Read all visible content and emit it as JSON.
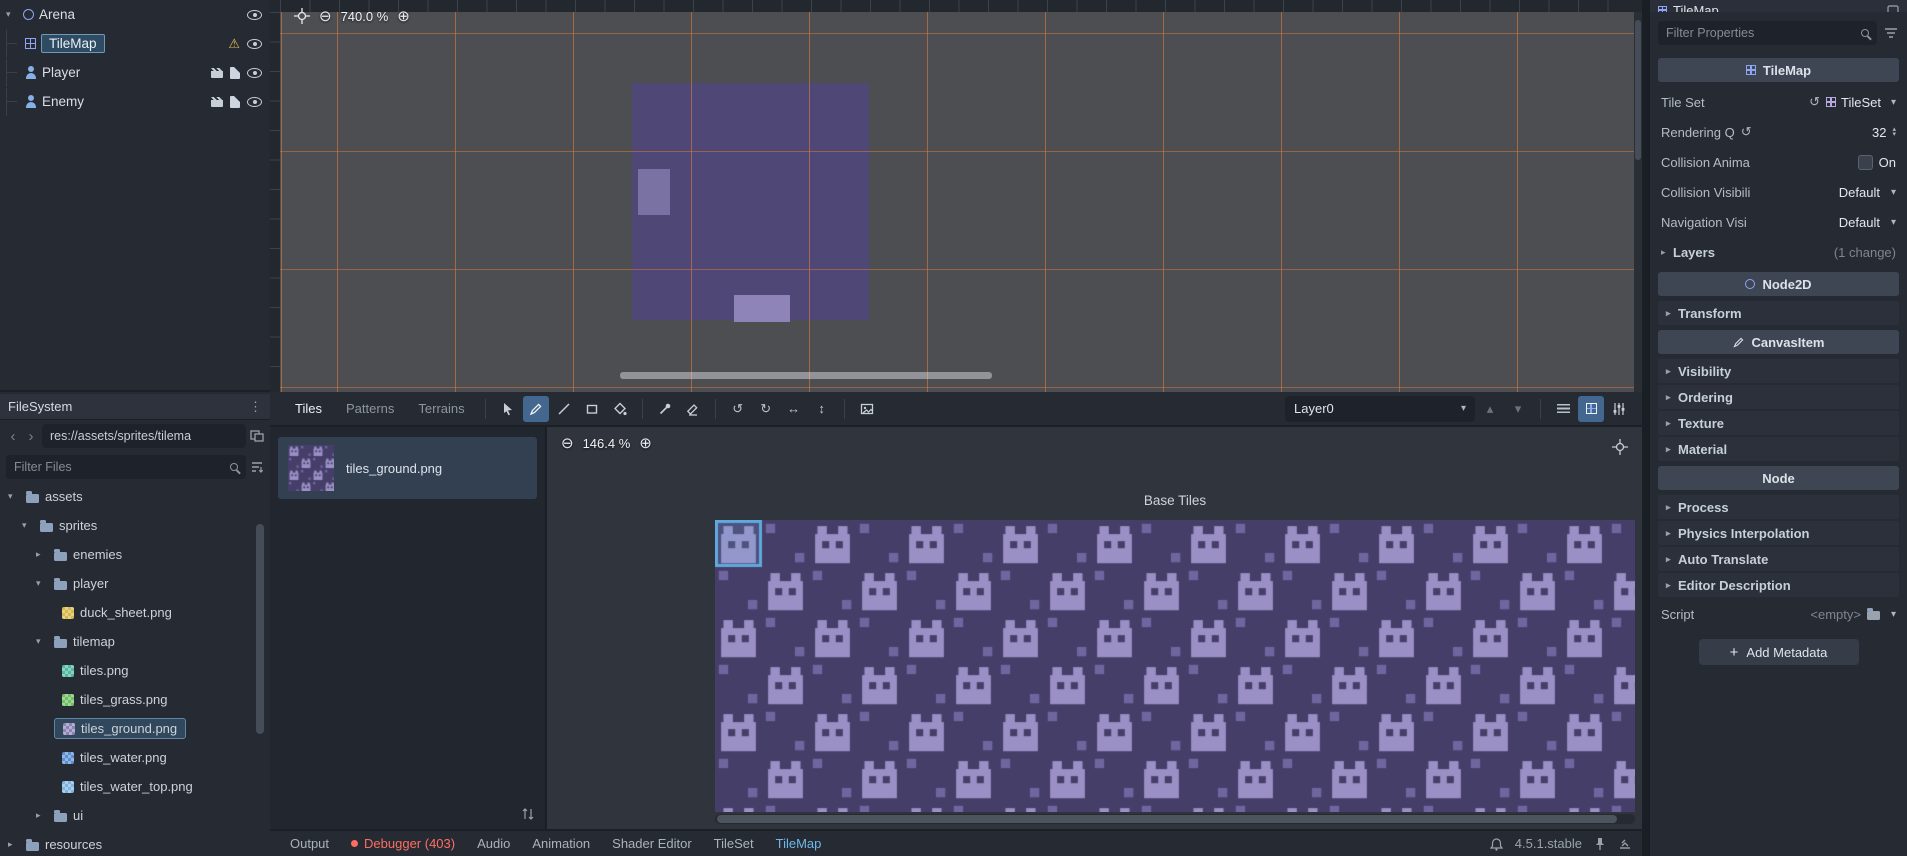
{
  "colors": {
    "accent": "#5fa9dd",
    "grid_orange": "#d4763b",
    "tile_dark": "#453e68",
    "tile_mid": "#6f66a0",
    "tile_light": "#9b90c5",
    "map_purple": "#4f4876",
    "map_light1": "#7b72a4",
    "map_light2": "#8e84b7",
    "warning": "#e0b84f",
    "error_red": "#ff6d61"
  },
  "scene_tree": {
    "nodes": [
      {
        "label": "Arena"
      },
      {
        "label": "TileMap"
      },
      {
        "label": "Player"
      },
      {
        "label": "Enemy"
      }
    ]
  },
  "filesystem": {
    "title": "FileSystem",
    "path": "res://assets/sprites/tilema",
    "filter_placeholder": "Filter Files",
    "items": [
      {
        "label": "assets"
      },
      {
        "label": "sprites"
      },
      {
        "label": "enemies"
      },
      {
        "label": "player"
      },
      {
        "label": "duck_sheet.png",
        "tint": "#d8b84a"
      },
      {
        "label": "tilemap"
      },
      {
        "label": "tiles.png",
        "tint": "#53b8a0"
      },
      {
        "label": "tiles_grass.png",
        "tint": "#6fbf63"
      },
      {
        "label": "tiles_ground.png",
        "tint": "#8d82b5"
      },
      {
        "label": "tiles_water.png",
        "tint": "#5a8fd0"
      },
      {
        "label": "tiles_water_top.png",
        "tint": "#7fb3e0"
      },
      {
        "label": "ui"
      },
      {
        "label": "resources"
      }
    ]
  },
  "viewport": {
    "zoom": "740.0 %"
  },
  "tile_panel": {
    "tabs": [
      {
        "label": "Tiles"
      },
      {
        "label": "Patterns"
      },
      {
        "label": "Terrains"
      }
    ],
    "layer": "Layer0",
    "source_item": "tiles_ground.png",
    "atlas_zoom": "146.4 %",
    "atlas_title": "Base Tiles"
  },
  "bottom_bar": {
    "tabs": [
      {
        "label": "Output"
      },
      {
        "label": "Debugger (403)"
      },
      {
        "label": "Audio"
      },
      {
        "label": "Animation"
      },
      {
        "label": "Shader Editor"
      },
      {
        "label": "TileSet"
      },
      {
        "label": "TileMap"
      }
    ],
    "version": "4.5.1.stable"
  },
  "inspector": {
    "node_name": "TileMap",
    "filter_placeholder": "Filter Properties",
    "header_tilemap": "TileMap",
    "tile_set_label": "Tile Set",
    "tile_set_value": "TileSet",
    "rendering_label": "Rendering Q",
    "rendering_value": "32",
    "collision_anim_label": "Collision Anima",
    "collision_anim_value": "On",
    "collision_vis_label": "Collision Visibili",
    "collision_vis_value": "Default",
    "nav_vis_label": "Navigation Visi",
    "nav_vis_value": "Default",
    "layers_label": "Layers",
    "layers_value": "(1 change)",
    "header_node2d": "Node2D",
    "group_transform": "Transform",
    "header_canvasitem": "CanvasItem",
    "group_visibility": "Visibility",
    "group_ordering": "Ordering",
    "group_texture": "Texture",
    "group_material": "Material",
    "header_node": "Node",
    "group_process": "Process",
    "group_physics": "Physics Interpolation",
    "group_auto": "Auto Translate",
    "group_editor": "Editor Description",
    "script_label": "Script",
    "script_value": "<empty>",
    "add_metadata": "Add Metadata"
  }
}
